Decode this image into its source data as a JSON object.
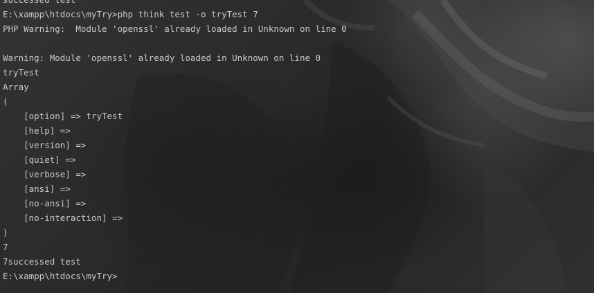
{
  "terminal": {
    "lines": [
      "successed test",
      "E:\\xampp\\htdocs\\myTry>php think test -o tryTest 7",
      "PHP Warning:  Module 'openssl' already loaded in Unknown on line 0",
      "",
      "Warning: Module 'openssl' already loaded in Unknown on line 0",
      "tryTest",
      "Array",
      "(",
      "    [option] => tryTest",
      "    [help] =>",
      "    [version] =>",
      "    [quiet] =>",
      "    [verbose] =>",
      "    [ansi] =>",
      "    [no-ansi] =>",
      "    [no-interaction] =>",
      ")",
      "7",
      "7successed test",
      "E:\\xampp\\htdocs\\myTry>"
    ]
  }
}
